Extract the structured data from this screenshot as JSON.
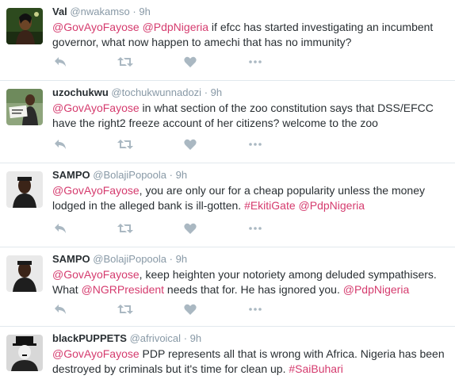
{
  "tweets": [
    {
      "name": "Val",
      "handle": "@nwakamso",
      "dot": "·",
      "time": "9h",
      "text": [
        {
          "t": "@GovAyoFayose",
          "m": true
        },
        {
          "t": " ",
          "m": false
        },
        {
          "t": "@PdpNigeria",
          "m": true
        },
        {
          "t": " if efcc has started investigating an incumbent governor,  what now happen to amechi that has no immunity?",
          "m": false
        }
      ]
    },
    {
      "name": "uzochukwu",
      "handle": "@tochukwunnadozi",
      "dot": "·",
      "time": "9h",
      "text": [
        {
          "t": "@GovAyoFayose",
          "m": true
        },
        {
          "t": "  in what section of the zoo constitution says that DSS/EFCC have the right2 freeze account of her citizens? welcome to the zoo",
          "m": false
        }
      ]
    },
    {
      "name": "SAMPO",
      "handle": "@BolajiPopoola",
      "dot": "·",
      "time": "9h",
      "text": [
        {
          "t": "@GovAyoFayose",
          "m": true
        },
        {
          "t": ", you are only our for a cheap popularity unless the money lodged in the alleged bank is ill-gotten. ",
          "m": false
        },
        {
          "t": "#EkitiGate",
          "m": true
        },
        {
          "t": "  ",
          "m": false
        },
        {
          "t": "@PdpNigeria",
          "m": true
        }
      ]
    },
    {
      "name": "SAMPO",
      "handle": "@BolajiPopoola",
      "dot": "·",
      "time": "9h",
      "text": [
        {
          "t": "@GovAyoFayose",
          "m": true
        },
        {
          "t": ", keep heighten your notoriety among deluded sympathisers. What ",
          "m": false
        },
        {
          "t": "@NGRPresident",
          "m": true
        },
        {
          "t": "  needs that for. He has ignored you. ",
          "m": false
        },
        {
          "t": "@PdpNigeria",
          "m": true
        }
      ]
    },
    {
      "name": "blackPUPPETS",
      "handle": "@afrivoical",
      "dot": "·",
      "time": "9h",
      "text": [
        {
          "t": "@GovAyoFayose",
          "m": true
        },
        {
          "t": " PDP represents all that is wrong with Africa. Nigeria has been destroyed by criminals but it's time for clean up. ",
          "m": false
        },
        {
          "t": "#SaiBuhari",
          "m": true
        }
      ]
    }
  ],
  "icons": [
    "reply-icon",
    "retweet-icon",
    "like-icon",
    "more-icon"
  ],
  "colors": {
    "mention": "#d53b6e",
    "muted": "#8899a6",
    "icon": "#aab8c2",
    "divider": "#e1e8ed"
  }
}
